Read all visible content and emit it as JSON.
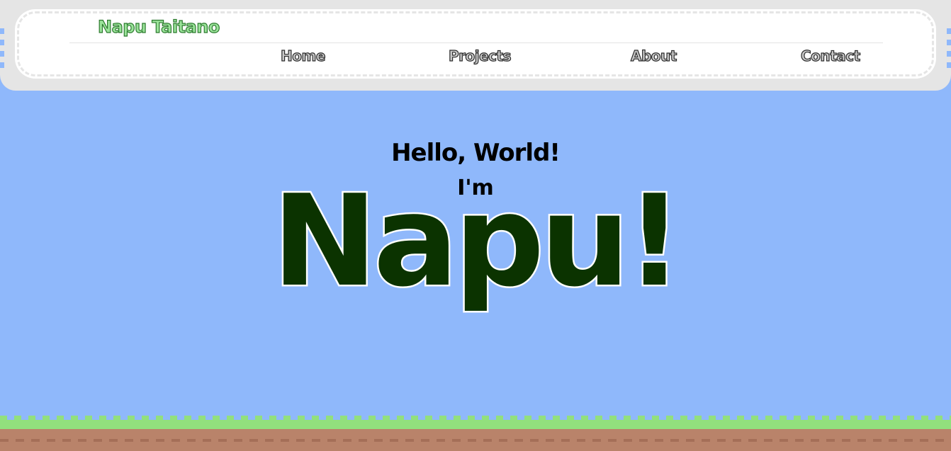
{
  "header": {
    "site_title": "Napu Taitano",
    "nav": [
      {
        "label": "Home"
      },
      {
        "label": "Projects"
      },
      {
        "label": "About"
      },
      {
        "label": "Contact"
      }
    ]
  },
  "hero": {
    "greeting": "Hello, World!",
    "intro": "I'm",
    "name": "Napu!"
  },
  "colors": {
    "sky": "#8fb8fb",
    "header_frame": "#e5e5e5",
    "header_panel": "#ffffff",
    "title_fill": "#9be39a",
    "name_fill": "#0b3300",
    "grass": "#92e07d",
    "dirt": "#b9836a"
  }
}
